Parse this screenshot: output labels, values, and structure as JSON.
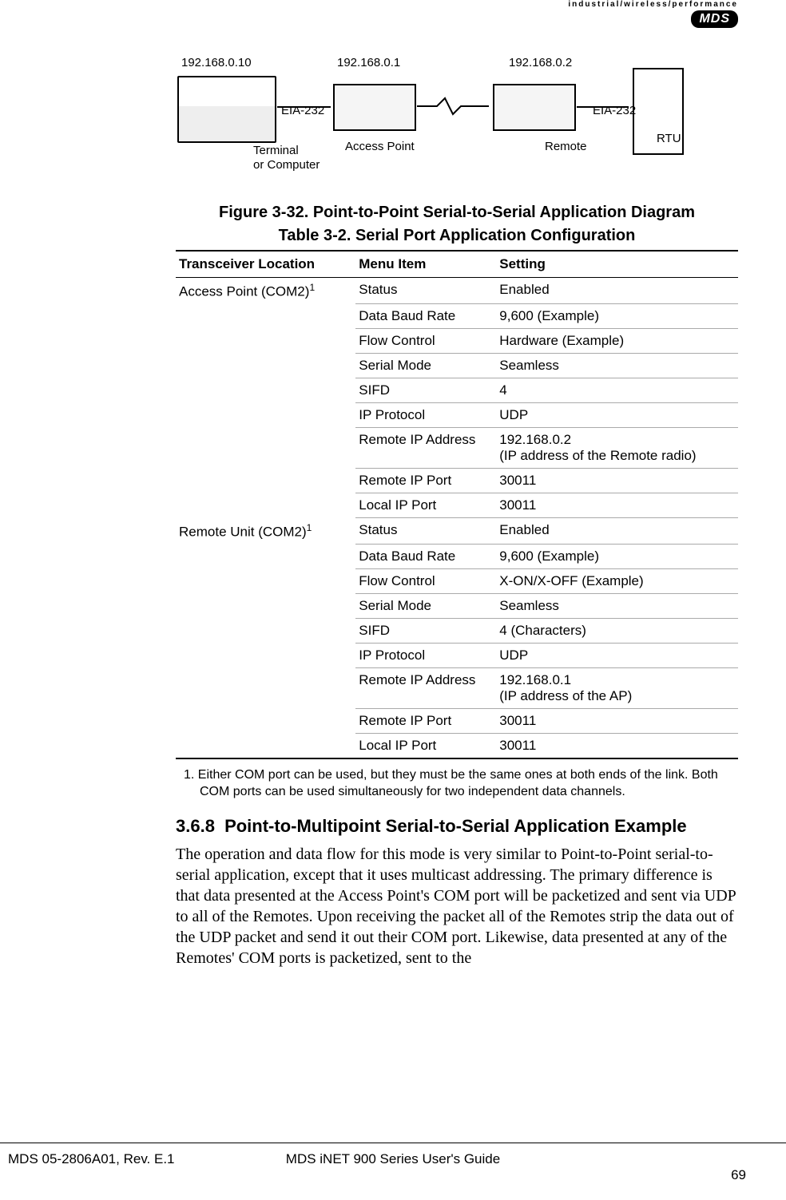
{
  "brand": {
    "tagline": "industrial/wireless/performance",
    "logo": "MDS"
  },
  "diagram": {
    "ip1": "192.168.0.10",
    "ip2": "192.168.0.1",
    "ip3": "192.168.0.2",
    "eia1": "EIA-232",
    "eia2": "EIA-232",
    "ap_label": "Access Point",
    "remote_label": "Remote",
    "rtu_label": "RTU",
    "terminal_label": "Terminal\nor Computer"
  },
  "figure_caption": "Figure 3-32. Point-to-Point Serial-to-Serial Application Diagram",
  "table_caption": "Table 3-2. Serial Port Application Configuration",
  "table": {
    "headers": [
      "Transceiver Location",
      "Menu Item",
      "Setting"
    ],
    "groups": [
      {
        "location": "Access Point (COM2)",
        "location_sup": "1",
        "rows": [
          {
            "menu": "Status",
            "setting": "Enabled"
          },
          {
            "menu": "Data Baud Rate",
            "setting": "9,600 (Example)"
          },
          {
            "menu": "Flow Control",
            "setting": "Hardware (Example)"
          },
          {
            "menu": "Serial Mode",
            "setting": "Seamless"
          },
          {
            "menu": "SIFD",
            "setting": "4"
          },
          {
            "menu": "IP Protocol",
            "setting": "UDP"
          },
          {
            "menu": "Remote IP Address",
            "setting": "192.168.0.2\n(IP address of the Remote radio)"
          },
          {
            "menu": "Remote IP Port",
            "setting": "30011"
          },
          {
            "menu": "Local IP Port",
            "setting": "30011"
          }
        ]
      },
      {
        "location": "Remote Unit (COM2)",
        "location_sup": "1",
        "rows": [
          {
            "menu": "Status",
            "setting": "Enabled"
          },
          {
            "menu": "Data Baud Rate",
            "setting": "9,600 (Example)"
          },
          {
            "menu": "Flow Control",
            "setting": "X-ON/X-OFF (Example)"
          },
          {
            "menu": "Serial Mode",
            "setting": "Seamless"
          },
          {
            "menu": "SIFD",
            "setting": "4 (Characters)"
          },
          {
            "menu": "IP Protocol",
            "setting": "UDP"
          },
          {
            "menu": "Remote IP Address",
            "setting": "192.168.0.1\n(IP address of the AP)"
          },
          {
            "menu": "Remote IP Port",
            "setting": "30011"
          },
          {
            "menu": "Local IP Port",
            "setting": "30011"
          }
        ]
      }
    ]
  },
  "footnote": "1.  Either COM port can be used, but they must be the same ones at both ends of the link. Both COM ports can be used simultaneously for two independent data channels.",
  "section": {
    "number": "3.6.8",
    "title": "Point-to-Multipoint Serial-to-Serial Application Example"
  },
  "body": "The operation and data flow for this mode is very similar to Point-to-Point serial-to-serial application, except that it uses multicast addressing. The primary difference is that data presented at the Access Point's COM port will be packetized and sent via UDP to all of the Remotes. Upon receiving the packet all of the Remotes strip the data out of the UDP packet and send it out their COM port. Likewise, data presented at any of the Remotes' COM ports is packetized, sent to the",
  "footer": {
    "left": "MDS 05-2806A01, Rev. E.1",
    "center": "MDS iNET 900 Series User's Guide",
    "right": "69"
  }
}
